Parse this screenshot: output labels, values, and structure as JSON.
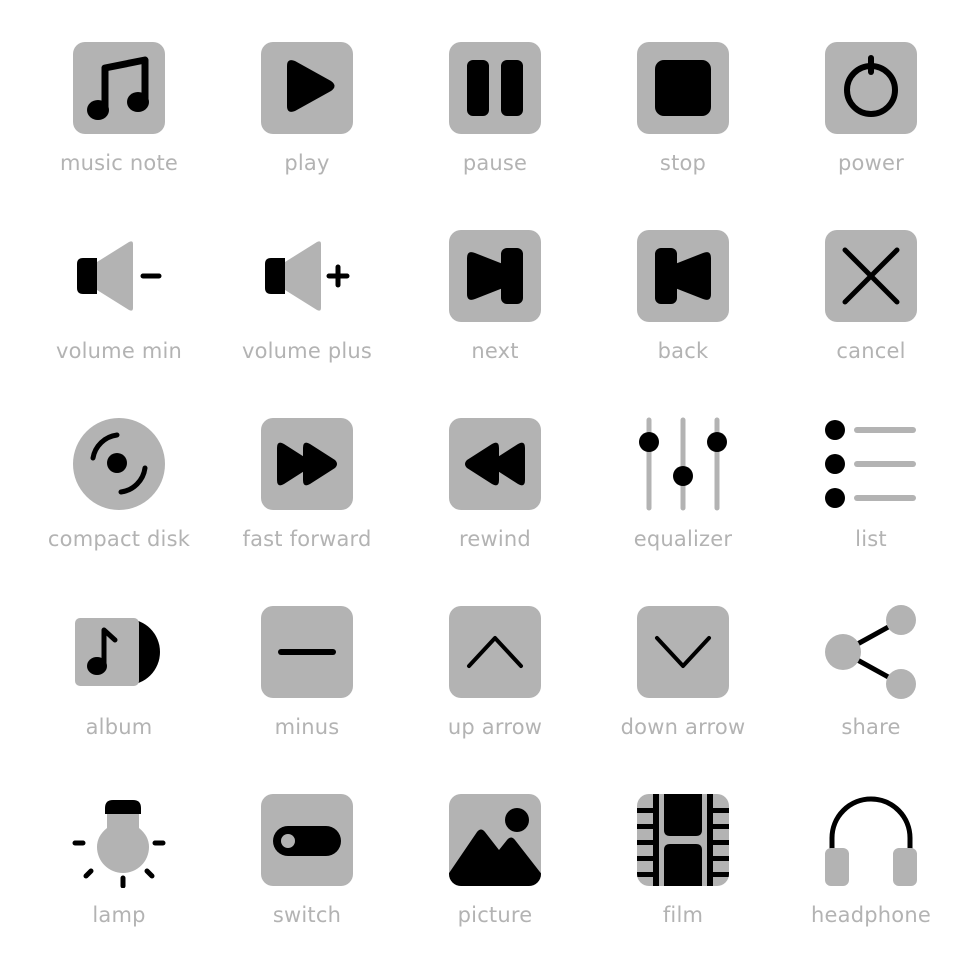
{
  "colors": {
    "tile": "#b3b3b3",
    "glyph": "#000000",
    "label": "#b3b3b3",
    "background": "#ffffff"
  },
  "icons": [
    {
      "id": "music-note",
      "label": "music note"
    },
    {
      "id": "play",
      "label": "play"
    },
    {
      "id": "pause",
      "label": "pause"
    },
    {
      "id": "stop",
      "label": "stop"
    },
    {
      "id": "power",
      "label": "power"
    },
    {
      "id": "volume-min",
      "label": "volume min"
    },
    {
      "id": "volume-plus",
      "label": "volume plus"
    },
    {
      "id": "next",
      "label": "next"
    },
    {
      "id": "back",
      "label": "back"
    },
    {
      "id": "cancel",
      "label": "cancel"
    },
    {
      "id": "compact-disk",
      "label": "compact disk"
    },
    {
      "id": "fast-forward",
      "label": "fast forward"
    },
    {
      "id": "rewind",
      "label": "rewind"
    },
    {
      "id": "equalizer",
      "label": "equalizer"
    },
    {
      "id": "list",
      "label": "list"
    },
    {
      "id": "album",
      "label": "album"
    },
    {
      "id": "minus",
      "label": "minus"
    },
    {
      "id": "up-arrow",
      "label": "up arrow"
    },
    {
      "id": "down-arrow",
      "label": "down arrow"
    },
    {
      "id": "share",
      "label": "share"
    },
    {
      "id": "lamp",
      "label": "lamp"
    },
    {
      "id": "switch",
      "label": "switch"
    },
    {
      "id": "picture",
      "label": "picture"
    },
    {
      "id": "film",
      "label": "film"
    },
    {
      "id": "headphone",
      "label": "headphone"
    }
  ]
}
